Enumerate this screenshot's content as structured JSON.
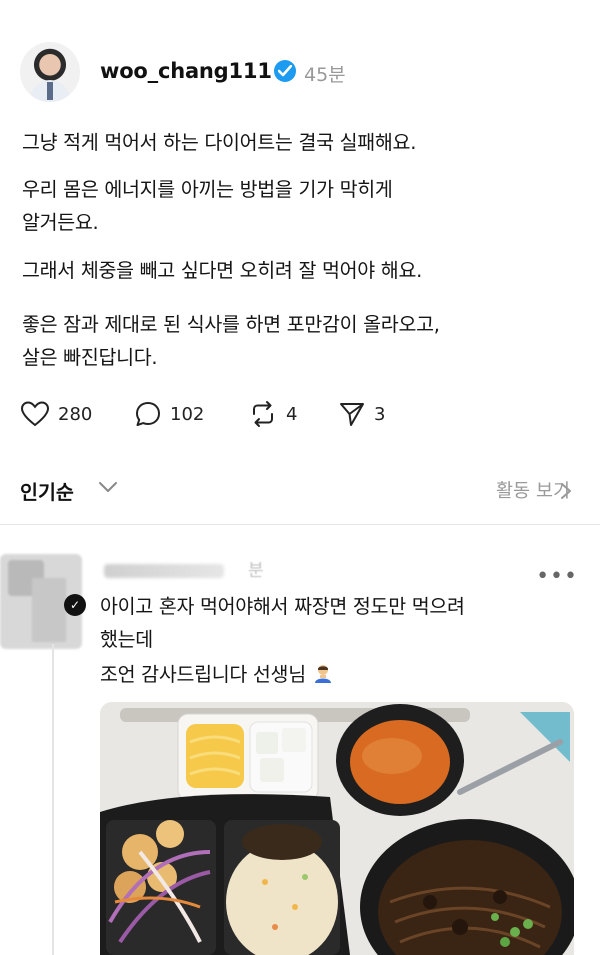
{
  "post": {
    "username": "woo_chang111",
    "time": "45분",
    "paragraphs": [
      "그냥 적게 먹어서 하는 다이어트는 결국 실패해요.",
      "우리 몸은 에너지를 아끼는 방법을 기가 막히게",
      "알거든요.",
      "그래서 체중을 빼고 싶다면 오히려 잘 먹어야 해요.",
      "좋은 잠과 제대로 된 식사를 하면 포만감이 올라오고,",
      "살은 빠진답니다."
    ],
    "likes": "280",
    "replies": "102",
    "reposts": "4",
    "shares": "3"
  },
  "sort": {
    "label": "인기순",
    "activity": "활동 보기"
  },
  "reply": {
    "time": "분",
    "lines": [
      "아이고 혼자 먹어야해서 짜장면 정도만 먹으려",
      "했는데",
      "조언 감사드립니다 선생님"
    ],
    "more": "•••"
  },
  "icons": {
    "verified": "verified-badge-icon",
    "like": "heart-icon",
    "reply": "comment-icon",
    "repost": "repost-icon",
    "share": "send-icon"
  },
  "colors": {
    "verified": "#1d9bf0",
    "muted": "#999999"
  }
}
